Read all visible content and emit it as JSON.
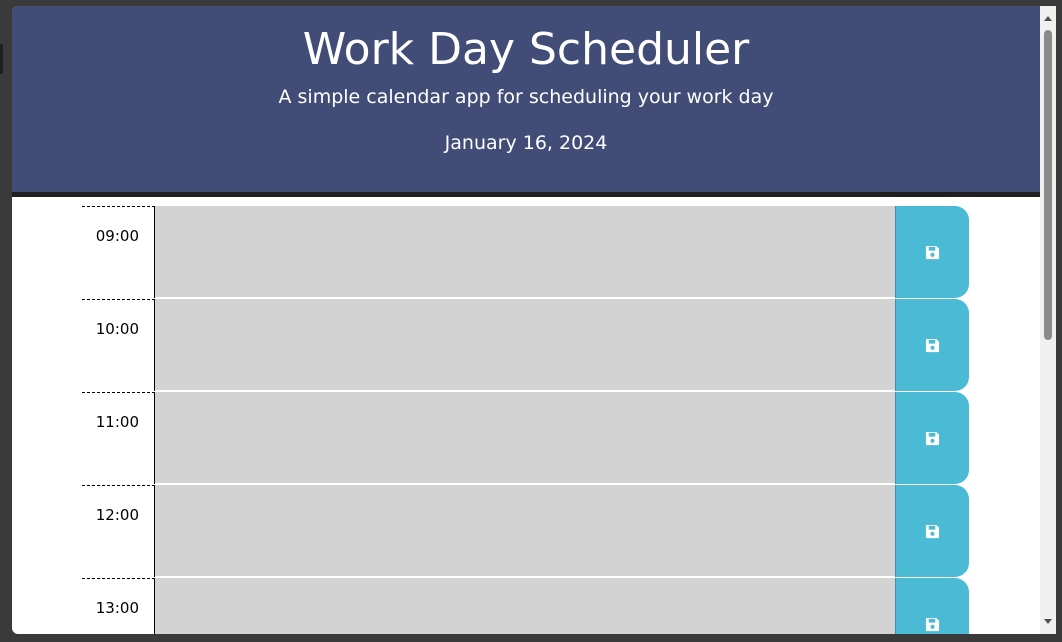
{
  "header": {
    "title": "Work Day Scheduler",
    "subtitle": "A simple calendar app for scheduling your work day",
    "date": "January 16, 2024"
  },
  "schedule": {
    "rows": [
      {
        "hour": "09:00",
        "description": ""
      },
      {
        "hour": "10:00",
        "description": ""
      },
      {
        "hour": "11:00",
        "description": ""
      },
      {
        "hour": "12:00",
        "description": ""
      },
      {
        "hour": "13:00",
        "description": ""
      }
    ],
    "save_icon": "floppy-disk-icon"
  },
  "colors": {
    "header_bg": "#424d77",
    "row_bg_past": "#d3d3d3",
    "save_button": "#4bbbd5"
  }
}
